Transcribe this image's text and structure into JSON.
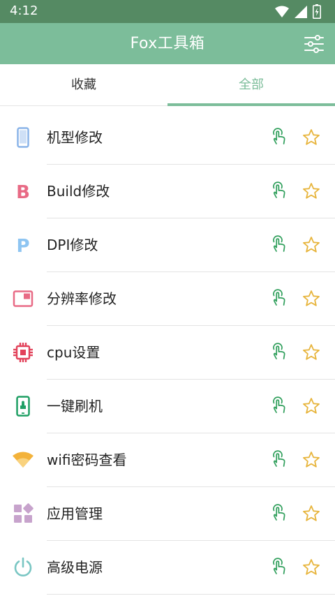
{
  "status_bar": {
    "time": "4:12"
  },
  "app_bar": {
    "title": "Fox工具箱"
  },
  "tabs": [
    {
      "label": "收藏",
      "selected": false
    },
    {
      "label": "全部",
      "selected": true
    }
  ],
  "colors": {
    "status_bar": "#558a63",
    "app_bar": "#7cbd9a",
    "accent": "#7cbd9a",
    "touch_icon": "#2e9e5a",
    "star_icon": "#e7b43b"
  },
  "items": [
    {
      "label": "机型修改",
      "icon": "phone-icon",
      "color": "#8ab4e8"
    },
    {
      "label": "Build修改",
      "icon": "letter-b-icon",
      "color": "#e86a85"
    },
    {
      "label": "DPI修改",
      "icon": "letter-p-icon",
      "color": "#8ec5f2"
    },
    {
      "label": "分辨率修改",
      "icon": "screen-resolution-icon",
      "color": "#e86a85"
    },
    {
      "label": "cpu设置",
      "icon": "cpu-chip-icon",
      "color": "#e2425a"
    },
    {
      "label": "一键刷机",
      "icon": "phone-flash-icon",
      "color": "#1f9f64"
    },
    {
      "label": "wifi密码查看",
      "icon": "wifi-icon",
      "color": "#f3b23a"
    },
    {
      "label": "应用管理",
      "icon": "apps-grid-icon",
      "color": "#c7a3cc"
    },
    {
      "label": "高级电源",
      "icon": "power-icon",
      "color": "#79c6c3"
    }
  ]
}
